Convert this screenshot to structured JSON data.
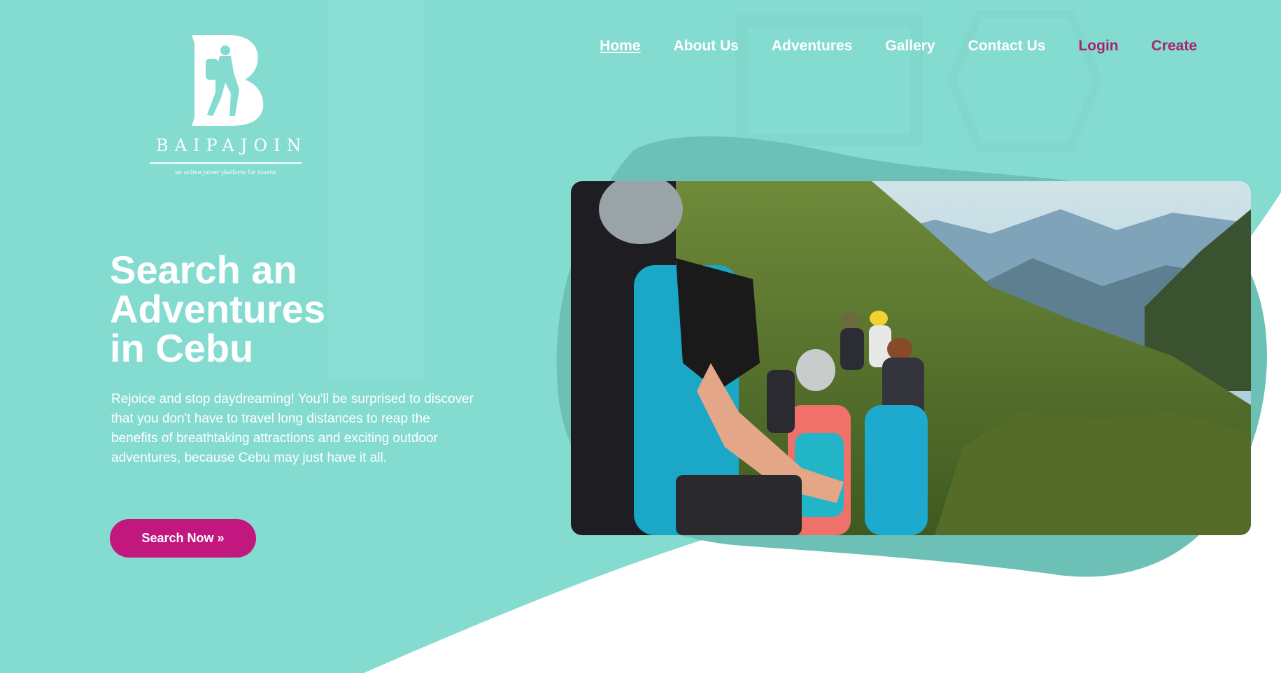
{
  "brand": {
    "name": "BAIPAJOIN",
    "tagline": "an online joiner platform for tourist"
  },
  "nav": {
    "items": [
      {
        "label": "Home"
      },
      {
        "label": "About Us"
      },
      {
        "label": "Adventures"
      },
      {
        "label": "Gallery"
      },
      {
        "label": "Contact Us"
      },
      {
        "label": "Login"
      },
      {
        "label": "Create"
      }
    ]
  },
  "hero": {
    "title_lines": [
      "Search an",
      "Adventures",
      "in Cebu"
    ],
    "description": "Rejoice and stop daydreaming! You'll be surprised to discover that you don't have to travel long distances to reap the benefits of breathtaking attractions and exciting outdoor adventures, because Cebu may just have it all.",
    "cta_label": "Search Now »"
  },
  "colors": {
    "teal": "#84dbd0",
    "teal_dark": "#6cc0b6",
    "accent": "#c2177e",
    "nav_accent": "#a8246f",
    "text": "#ffffff"
  },
  "icons": {
    "logo": "hiker-b-logo-icon"
  }
}
